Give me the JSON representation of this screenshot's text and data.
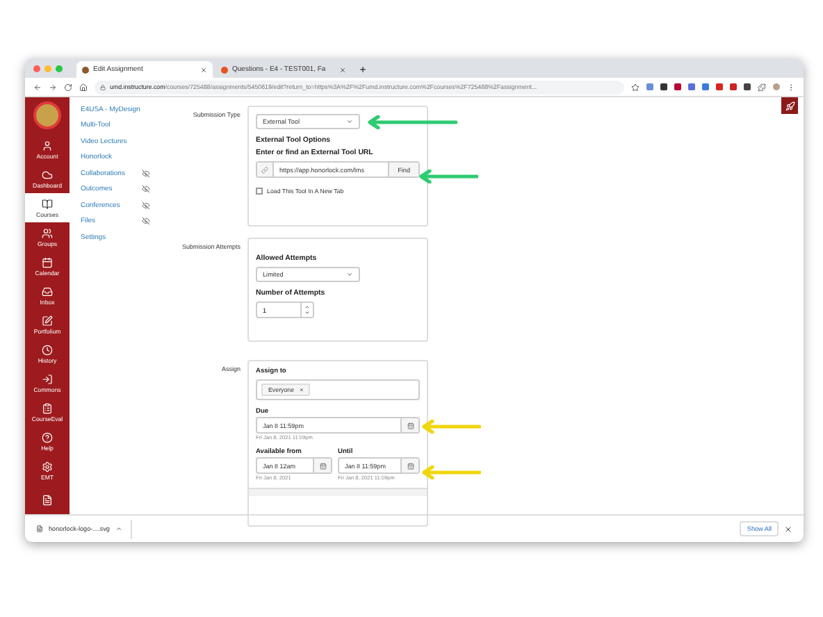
{
  "browser": {
    "tabs": [
      {
        "title": "Edit Assignment",
        "selected": true
      },
      {
        "title": "Questions - E4 - TEST001, Fa",
        "selected": false
      }
    ],
    "url_host": "umd.instructure.com",
    "url_path": "/courses/725488/assignments/5450619/edit?return_to=https%3A%2F%2Fumd.instructure.com%2Fcourses%2F725488%2Fassignment..."
  },
  "global_nav": [
    {
      "label": "Account",
      "selected": false
    },
    {
      "label": "Dashboard",
      "selected": false
    },
    {
      "label": "Courses",
      "selected": true
    },
    {
      "label": "Groups",
      "selected": false
    },
    {
      "label": "Calendar",
      "selected": false
    },
    {
      "label": "Inbox",
      "selected": false
    },
    {
      "label": "Portfolium",
      "selected": false
    },
    {
      "label": "History",
      "selected": false
    },
    {
      "label": "Commons",
      "selected": false
    },
    {
      "label": "CourseEval",
      "selected": false
    },
    {
      "label": "Help",
      "selected": false
    },
    {
      "label": "EMT",
      "selected": false
    }
  ],
  "course_nav": [
    {
      "label": "E4USA - MyDesign",
      "hidden": false
    },
    {
      "label": "Multi-Tool",
      "hidden": false
    },
    {
      "label": "Video Lectures",
      "hidden": false
    },
    {
      "label": "Honorlock",
      "hidden": false
    },
    {
      "label": "Collaborations",
      "hidden": true
    },
    {
      "label": "Outcomes",
      "hidden": true
    },
    {
      "label": "Conferences",
      "hidden": true
    },
    {
      "label": "Files",
      "hidden": true
    },
    {
      "label": "Settings",
      "hidden": false
    }
  ],
  "submission_type": {
    "label": "Submission Type",
    "value": "External Tool",
    "options_title": "External Tool Options",
    "url_label": "Enter or find an External Tool URL",
    "url": "https://app.honorlock.com/lms",
    "find_button": "Find",
    "new_tab": {
      "label": "Load This Tool In A New Tab",
      "checked": false
    }
  },
  "submission_attempts": {
    "label": "Submission Attempts",
    "allowed_label": "Allowed Attempts",
    "allowed_value": "Limited",
    "number_label": "Number of Attempts",
    "number_value": "1"
  },
  "assign": {
    "label": "Assign",
    "assign_to_label": "Assign to",
    "assignees": [
      "Everyone"
    ],
    "remove_symbol": "×",
    "due_label": "Due",
    "due_value": "Jan 8 11:59pm",
    "due_hint": "Fri Jan 8, 2021 11:59pm",
    "from_label": "Available from",
    "from_value": "Jan 8 12am",
    "from_hint": "Fri Jan 8, 2021",
    "until_label": "Until",
    "until_value": "Jan 8 11:59pm",
    "until_hint": "Fri Jan 8, 2021 11:59pm"
  },
  "arrows": [
    {
      "color": "#2ecc71"
    },
    {
      "color": "#2ecc71"
    },
    {
      "color": "#f1d60f"
    },
    {
      "color": "#f1d60f"
    }
  ],
  "download_bar": {
    "file": "honorlock-logo-....svg",
    "show_all": "Show All"
  }
}
